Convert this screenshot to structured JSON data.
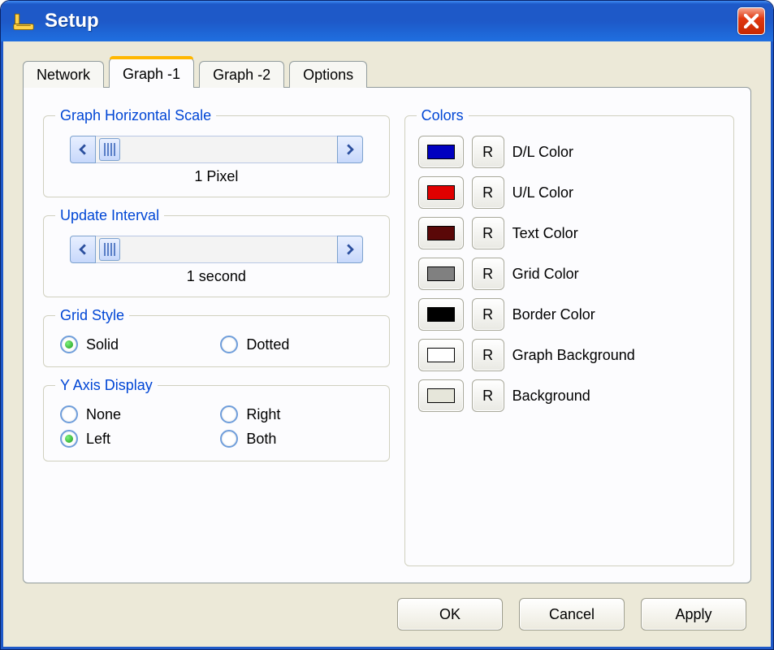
{
  "window": {
    "title": "Setup"
  },
  "tabs": [
    {
      "label": "Network",
      "active": false
    },
    {
      "label": "Graph -1",
      "active": true
    },
    {
      "label": "Graph -2",
      "active": false
    },
    {
      "label": "Options",
      "active": false
    }
  ],
  "graph_scale": {
    "legend": "Graph Horizontal Scale",
    "value_label": "1 Pixel"
  },
  "update_interval": {
    "legend": "Update Interval",
    "value_label": "1 second"
  },
  "grid_style": {
    "legend": "Grid Style",
    "options": [
      {
        "label": "Solid",
        "checked": true
      },
      {
        "label": "Dotted",
        "checked": false
      }
    ]
  },
  "y_axis": {
    "legend": "Y Axis Display",
    "options": [
      {
        "label": "None",
        "checked": false
      },
      {
        "label": "Right",
        "checked": false
      },
      {
        "label": "Left",
        "checked": true
      },
      {
        "label": "Both",
        "checked": false
      }
    ]
  },
  "colors": {
    "legend": "Colors",
    "reset_label": "R",
    "items": [
      {
        "label": "D/L Color",
        "hex": "#0000c0"
      },
      {
        "label": "U/L Color",
        "hex": "#e00000"
      },
      {
        "label": "Text Color",
        "hex": "#5a0808"
      },
      {
        "label": "Grid Color",
        "hex": "#808080"
      },
      {
        "label": "Border Color",
        "hex": "#000000"
      },
      {
        "label": "Graph Background",
        "hex": "#ffffff"
      },
      {
        "label": "Background",
        "hex": "#e6e6da"
      }
    ]
  },
  "footer": {
    "ok": "OK",
    "cancel": "Cancel",
    "apply": "Apply"
  }
}
